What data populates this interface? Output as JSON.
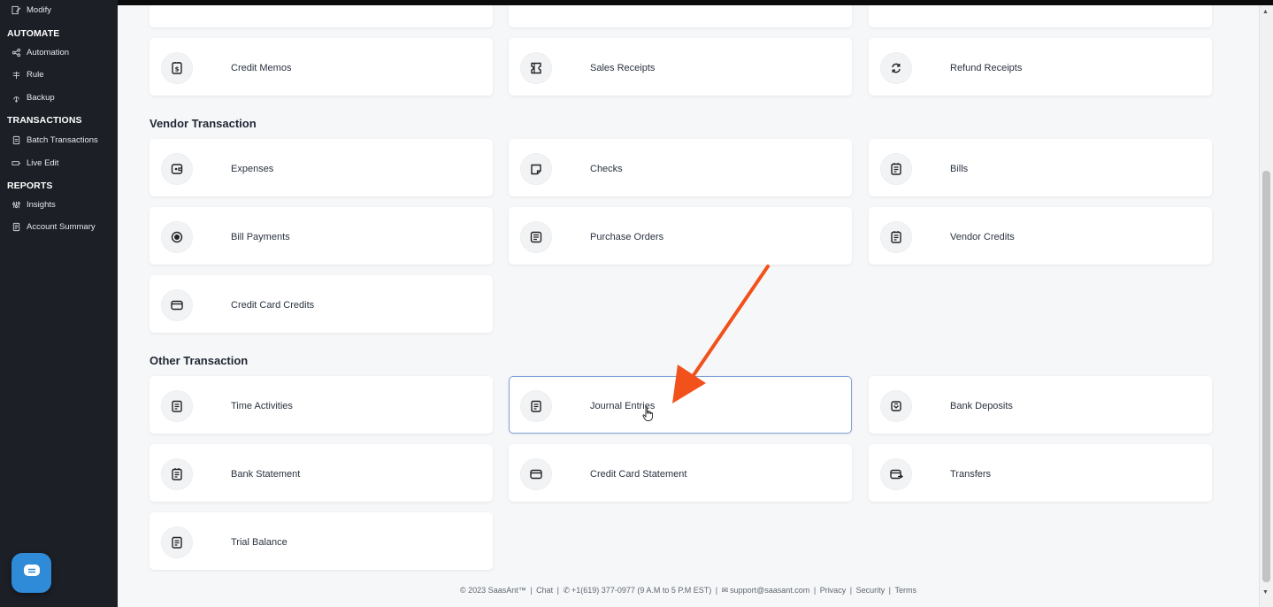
{
  "sidebar": {
    "top_item": {
      "label": "Modify",
      "icon": "modify-icon"
    },
    "sections": [
      {
        "title": "AUTOMATE",
        "items": [
          {
            "label": "Automation",
            "icon": "automation-icon"
          },
          {
            "label": "Rule",
            "icon": "rule-icon"
          },
          {
            "label": "Backup",
            "icon": "backup-icon"
          }
        ]
      },
      {
        "title": "TRANSACTIONS",
        "items": [
          {
            "label": "Batch Transactions",
            "icon": "batch-icon"
          },
          {
            "label": "Live Edit",
            "icon": "live-edit-icon"
          }
        ]
      },
      {
        "title": "REPORTS",
        "items": [
          {
            "label": "Insights",
            "icon": "insights-icon"
          },
          {
            "label": "Account Summary",
            "icon": "account-summary-icon"
          }
        ]
      }
    ]
  },
  "customer_row": [
    {
      "label": "Credit Memos",
      "icon": "document-dollar-icon"
    },
    {
      "label": "Sales Receipts",
      "icon": "receipt-icon"
    },
    {
      "label": "Refund Receipts",
      "icon": "refresh-icon"
    }
  ],
  "vendor": {
    "title": "Vendor Transaction",
    "cards": [
      {
        "label": "Expenses",
        "icon": "wallet-icon"
      },
      {
        "label": "Checks",
        "icon": "check-icon"
      },
      {
        "label": "Bills",
        "icon": "bill-icon"
      },
      {
        "label": "Bill Payments",
        "icon": "coin-icon"
      },
      {
        "label": "Purchase Orders",
        "icon": "purchase-order-icon"
      },
      {
        "label": "Vendor Credits",
        "icon": "bill-icon"
      },
      {
        "label": "Credit Card Credits",
        "icon": "credit-card-icon"
      }
    ]
  },
  "other": {
    "title": "Other Transaction",
    "cards": [
      {
        "label": "Time Activities",
        "icon": "document-icon"
      },
      {
        "label": "Journal Entries",
        "icon": "document-icon",
        "active": true
      },
      {
        "label": "Bank Deposits",
        "icon": "bank-deposit-icon"
      },
      {
        "label": "Bank Statement",
        "icon": "bill-icon"
      },
      {
        "label": "Credit Card Statement",
        "icon": "credit-card-icon"
      },
      {
        "label": "Transfers",
        "icon": "transfer-icon"
      },
      {
        "label": "Trial Balance",
        "icon": "document-icon"
      }
    ]
  },
  "footer": {
    "copyright": "© 2023 SaasAnt™",
    "chat": "Chat",
    "phone": "+1(619) 377-0977 (9 A.M to 5 P.M EST)",
    "email": "support@saasant.com",
    "privacy": "Privacy",
    "security": "Security",
    "terms": "Terms"
  },
  "colors": {
    "sidebar_bg": "#1c1f26",
    "accent_arrow": "#f2511b",
    "chat_button": "#2f8bd8",
    "active_border": "#7ea2d6"
  }
}
